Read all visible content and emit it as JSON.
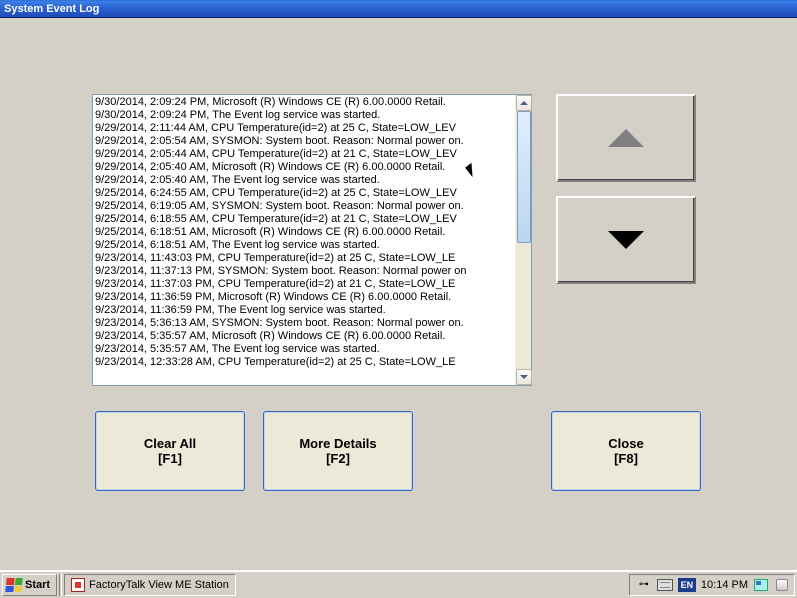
{
  "window": {
    "title": "System Event Log"
  },
  "log_entries": [
    "9/30/2014, 2:09:24 PM, Microsoft (R) Windows CE (R) 6.00.0000 Retail.",
    "9/30/2014, 2:09:24 PM, The Event log service was started.",
    "9/29/2014, 2:11:44 AM, CPU Temperature(id=2) at 25 C, State=LOW_LEV",
    "9/29/2014, 2:05:54 AM, SYSMON: System boot. Reason: Normal power on.",
    "9/29/2014, 2:05:44 AM, CPU Temperature(id=2) at 21 C, State=LOW_LEV",
    "9/29/2014, 2:05:40 AM, Microsoft (R) Windows CE (R) 6.00.0000 Retail.",
    "9/29/2014, 2:05:40 AM, The Event log service was started.",
    "9/25/2014, 6:24:55 AM, CPU Temperature(id=2) at 25 C, State=LOW_LEV",
    "9/25/2014, 6:19:05 AM, SYSMON: System boot. Reason: Normal power on.",
    "9/25/2014, 6:18:55 AM, CPU Temperature(id=2) at 21 C, State=LOW_LEV",
    "9/25/2014, 6:18:51 AM, Microsoft (R) Windows CE (R) 6.00.0000 Retail.",
    "9/25/2014, 6:18:51 AM, The Event log service was started.",
    "9/23/2014, 11:43:03 PM, CPU Temperature(id=2) at 25 C, State=LOW_LE",
    "9/23/2014, 11:37:13 PM, SYSMON: System boot. Reason: Normal power on",
    "9/23/2014, 11:37:03 PM, CPU Temperature(id=2) at 21 C, State=LOW_LE",
    "9/23/2014, 11:36:59 PM, Microsoft (R) Windows CE (R) 6.00.0000 Retail.",
    "9/23/2014, 11:36:59 PM, The Event log service was started.",
    "9/23/2014, 5:36:13 AM, SYSMON: System boot. Reason: Normal power on.",
    "9/23/2014, 5:35:57 AM, Microsoft (R) Windows CE (R) 6.00.0000 Retail.",
    "9/23/2014, 5:35:57 AM, The Event log service was started.",
    "9/23/2014, 12:33:28 AM, CPU Temperature(id=2) at 25 C, State=LOW_LE"
  ],
  "buttons": {
    "clear_all": {
      "label": "Clear All",
      "shortcut": "[F1]"
    },
    "more_details": {
      "label": "More Details",
      "shortcut": "[F2]"
    },
    "close": {
      "label": "Close",
      "shortcut": "[F8]"
    }
  },
  "taskbar": {
    "start": "Start",
    "task": "FactoryTalk View ME Station",
    "lang": "EN",
    "clock": "10:14 PM"
  }
}
